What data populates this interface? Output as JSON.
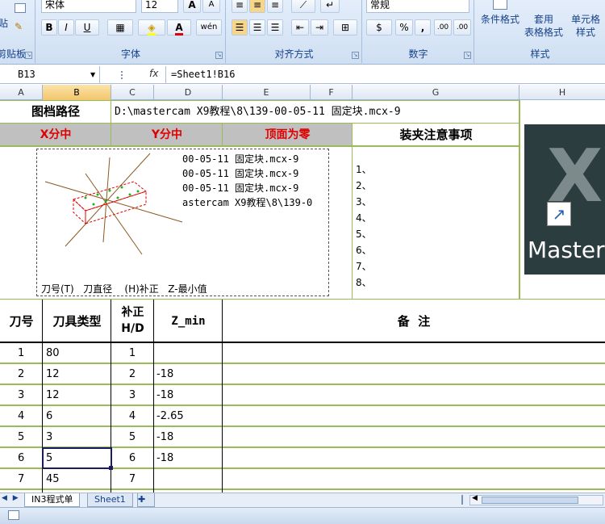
{
  "ribbon": {
    "font_name": "宋体",
    "font_size": "12",
    "number_format": "常规",
    "left_label_paste": "粘贴",
    "left_label_clipboard": "剪贴板",
    "groups": {
      "font": "字体",
      "alignment": "对齐方式",
      "number": "数字",
      "styles": "样式"
    },
    "bold": "B",
    "italic": "I",
    "underline": "U",
    "grow_font": "A",
    "shrink_font": "A",
    "percent": "%",
    "comma": ",",
    "phonetic": "wén",
    "increase_decimal": ".00",
    "decrease_decimal": ".00",
    "conditional_format": "条件格式",
    "format_as_table_1": "套用",
    "format_as_table_2": "表格格式",
    "cell_styles_1": "单元格",
    "cell_styles_2": "样式"
  },
  "formula_bar": {
    "name_box": "B13",
    "fx": "fx",
    "formula": "=Sheet1!B16"
  },
  "columns": [
    "A",
    "B",
    "C",
    "D",
    "E",
    "F",
    "G",
    "H"
  ],
  "row1": {
    "label": "图档路径",
    "path": "D:\\mastercam X9教程\\8\\139-00-05-11 固定块.mcx-9"
  },
  "row2": {
    "x_center": "X分中",
    "y_center": "Y分中",
    "top_zero": "顶面为零",
    "clamping_notes": "装夹注意事项"
  },
  "preview": {
    "lines": [
      "00-05-11 固定块.mcx-9",
      "00-05-11 固定块.mcx-9",
      "00-05-11 固定块.mcx-9",
      "astercam X9教程\\8\\139-0"
    ],
    "footer": "刀号(T)   刀直径    (H)补正   Z-最小值"
  },
  "notes_list": [
    "1、",
    "2、",
    "3、",
    "4、",
    "5、",
    "6、",
    "7、",
    "8、"
  ],
  "app_icon": {
    "text": "Master",
    "letter": "X"
  },
  "tool_table": {
    "headers": {
      "tool_no": "刀号",
      "tool_type": "刀具类型",
      "comp_1": "补正",
      "comp_2": "H/D",
      "zmin": "Z_min",
      "remarks": "备  注"
    },
    "rows": [
      {
        "no": "1",
        "type": "80",
        "hd": "1",
        "z": ""
      },
      {
        "no": "2",
        "type": "12",
        "hd": "2",
        "z": "-18"
      },
      {
        "no": "3",
        "type": "12",
        "hd": "3",
        "z": "-18"
      },
      {
        "no": "4",
        "type": "6",
        "hd": "4",
        "z": "-2.65"
      },
      {
        "no": "5",
        "type": "3",
        "hd": "5",
        "z": "-18"
      },
      {
        "no": "6",
        "type": "5",
        "hd": "6",
        "z": "-18"
      },
      {
        "no": "7",
        "type": "45",
        "hd": "7",
        "z": ""
      }
    ]
  },
  "sheet_tabs": [
    "IN3程式单",
    "Sheet1"
  ],
  "colors": {
    "red_text": "#e00000",
    "grid_green": "#9bbb59",
    "header_gray": "#c0c0c0",
    "ribbon_blue": "#15428b"
  }
}
